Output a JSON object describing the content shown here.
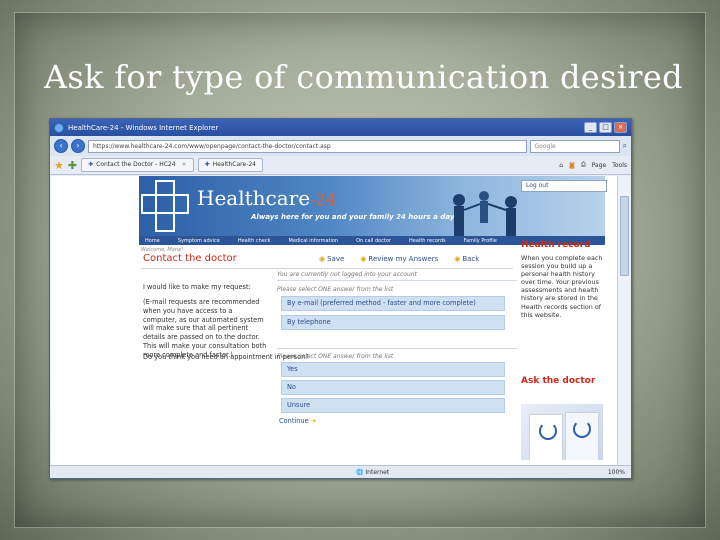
{
  "slide": {
    "title": "Ask for type of communication desired"
  },
  "browser": {
    "window_title": "HealthCare-24 - Windows Internet Explorer",
    "url": "https://www.healthcare-24.com/www/openpage/contact-the-doctor/contact.asp",
    "search_placeholder": "Google",
    "tabs": [
      {
        "label": "Contact the Doctor - HC24"
      },
      {
        "label": "HealthCare-24"
      }
    ],
    "tools": {
      "page": "Page",
      "tools": "Tools"
    },
    "status": {
      "zone": "Internet",
      "zoom": "100%"
    }
  },
  "site": {
    "brand": "Healthcare",
    "brand_num": "-24",
    "tagline": "Always here for you and your family 24 hours a day",
    "logout": "Log out",
    "nav": [
      "Home",
      "Symptom advice",
      "Health check",
      "Medical information",
      "On call doctor",
      "Health records",
      "Family Profile"
    ],
    "welcome": "Welcome, Marie!"
  },
  "page": {
    "title": "Contact the doctor",
    "actions": {
      "save": "Save",
      "review": "Review my Answers",
      "back": "Back"
    },
    "current_status": "You are currently not logged into your account",
    "q1": {
      "label": "I would like to make my request:",
      "note": "(E-mail requests are recommended when you have access to a computer, as our automated system will make sure that all pertinent details are passed on to the doctor. This will make your consultation both more complete and faster.)",
      "hint": "Please select ONE answer from the list",
      "options": [
        "By e-mail (preferred method - faster and more complete)",
        "By telephone"
      ]
    },
    "q2": {
      "label": "Do you think you need an appointment in person?",
      "hint": "Please select ONE answer from the list",
      "options": [
        "Yes",
        "No",
        "Unsure"
      ]
    },
    "continue": "Continue"
  },
  "sidebar": {
    "health_record_title": "Health record",
    "health_record_text": "When you complete each session you build up a personal health history over time. Your previous assessments and health history are stored in the Health records section of this website.",
    "ask_doctor_title": "Ask the doctor"
  }
}
